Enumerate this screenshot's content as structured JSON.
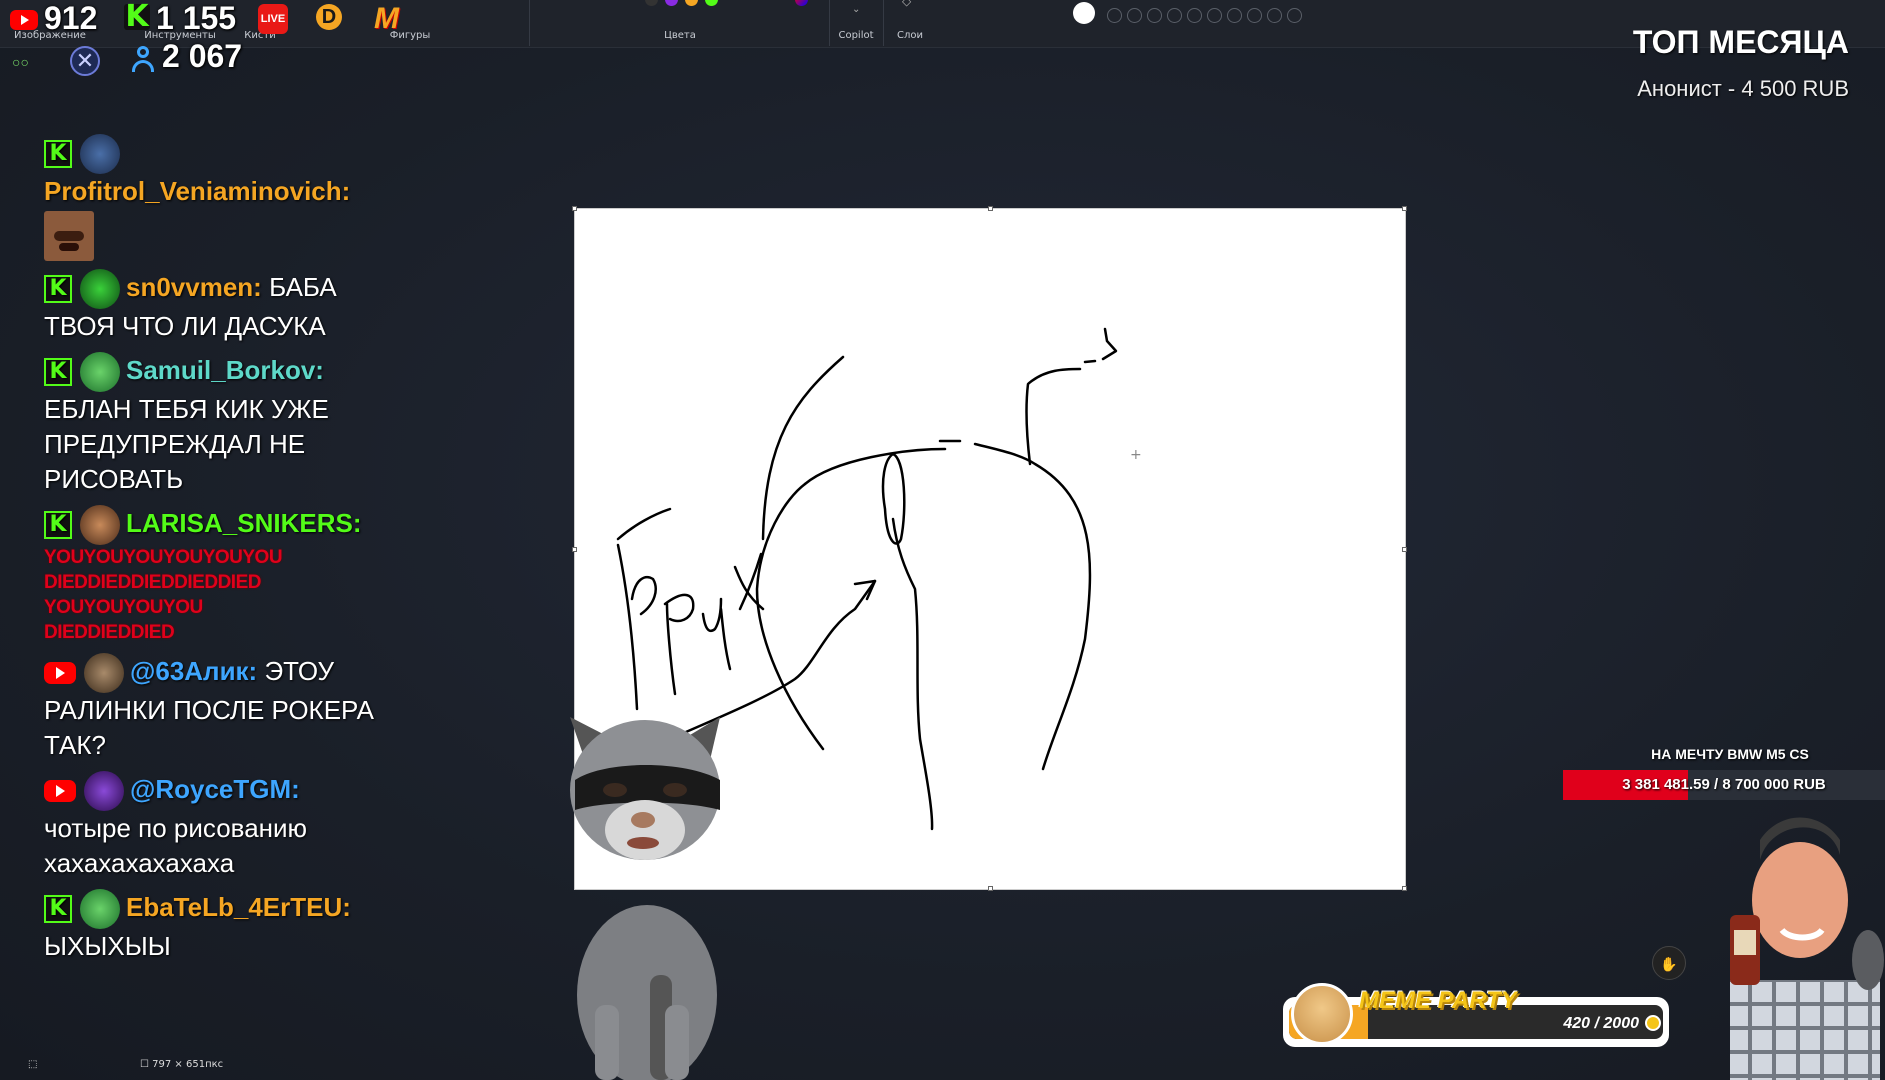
{
  "ribbon": {
    "image_label": "Изображение",
    "tools_label": "Инструменты",
    "brushes_label": "Кисти",
    "shapes_label": "Фигуры",
    "colors_label": "Цвета",
    "copilot_label": "Copilot",
    "layers_label": "Слои"
  },
  "stats": {
    "youtube_viewers": "912",
    "kick_viewers": "1 155",
    "total_viewers": "2 067",
    "live_badge": "LIVE"
  },
  "top_month": {
    "title": "ТОП МЕСЯЦА",
    "donor": "Анонист - 4 500 RUB"
  },
  "chat": [
    {
      "platform": "kick",
      "user": "Profitrol_Veniaminovich:",
      "user_color": "#f5a623",
      "text": "",
      "emote": true
    },
    {
      "platform": "kick",
      "user": "sn0vvmen:",
      "user_color": "#f5a623",
      "text": "БАБА ТВОЯ ЧТО ЛИ ДАСУКА"
    },
    {
      "platform": "kick",
      "user": "Samuil_Borkov:",
      "user_color": "#5ed9c9",
      "text": "ЕБЛАН ТЕБЯ КИК УЖЕ ПРЕДУПРЕЖДАЛ НЕ РИСОВАТЬ"
    },
    {
      "platform": "kick",
      "user": "LARISA_SNIKERS:",
      "user_color": "#53fc18",
      "text": "",
      "spam": [
        "YOUYOUYOUYOUYOUYOU",
        "DIEDDIEDDIEDDIEDDIED",
        "YOUYOUYOUYOU",
        "DIEDDIEDDIED"
      ]
    },
    {
      "platform": "youtube",
      "user": "@63Алик:",
      "user_color": "#3ea6ff",
      "text": "ЭТОУ РАЛИНКИ ПОСЛЕ РОКЕРА ТАК?"
    },
    {
      "platform": "youtube",
      "user": "@RoyceTGM:",
      "user_color": "#3ea6ff",
      "text": "чотыре по рисованию хахахахахахаха"
    },
    {
      "platform": "kick",
      "user": "EbaTeLb_4ErTEU:",
      "user_color": "#f5a623",
      "text": "ЫХЫХЫЫ"
    }
  ],
  "goal": {
    "label": "НА МЕЧТУ BMW M5 CS",
    "progress_text": "3 381 481.59 / 8 700 000 RUB",
    "progress_fraction": 0.389
  },
  "meme_party": {
    "title": "MEME PARTY",
    "count": "420 / 2000",
    "progress_fraction": 0.21
  },
  "status": {
    "canvas_size": "797 × 651пкс"
  },
  "colors": {
    "background": "#1b2029",
    "kick_green": "#53fc18",
    "youtube_red": "#ff0000",
    "goal_red": "#e0001b"
  }
}
